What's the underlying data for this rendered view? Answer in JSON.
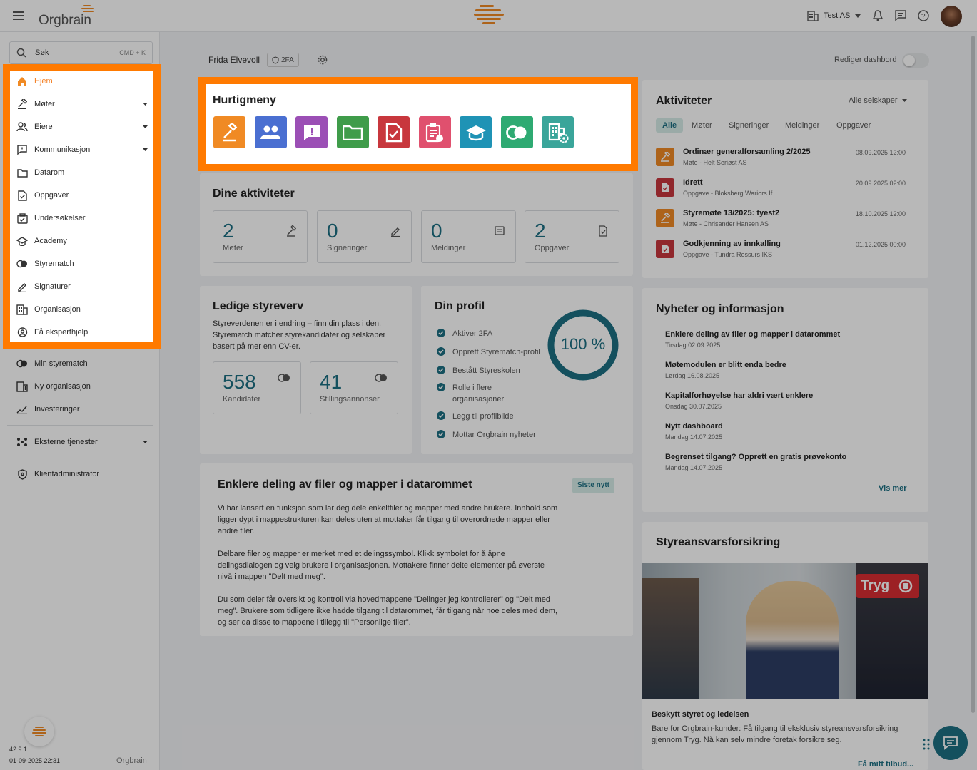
{
  "app": {
    "logo_text": "Orgbrain",
    "company_selector": "Test AS",
    "version": "42.9.1",
    "build_date": "01-09-2025 22:31",
    "footer_logo": "Orgbrain"
  },
  "search": {
    "label": "Søk",
    "shortcut": "CMD + K"
  },
  "sidebar": {
    "primary": [
      {
        "label": "Hjem",
        "icon": "home-icon",
        "active": true
      },
      {
        "label": "Møter",
        "icon": "gavel-icon",
        "chevron": true
      },
      {
        "label": "Eiere",
        "icon": "owners-icon",
        "chevron": true
      },
      {
        "label": "Kommunikasjon",
        "icon": "message-icon",
        "chevron": true
      },
      {
        "label": "Datarom",
        "icon": "folder-icon"
      },
      {
        "label": "Oppgaver",
        "icon": "task-icon"
      },
      {
        "label": "Undersøkelser",
        "icon": "survey-icon"
      },
      {
        "label": "Academy",
        "icon": "academy-icon"
      },
      {
        "label": "Styrematch",
        "icon": "styrematch-icon"
      },
      {
        "label": "Signaturer",
        "icon": "signature-icon"
      },
      {
        "label": "Organisasjon",
        "icon": "organization-icon"
      },
      {
        "label": "Få eksperthjelp",
        "icon": "expert-icon"
      }
    ],
    "secondary": [
      {
        "label": "Min styrematch"
      },
      {
        "label": "Ny organisasjon"
      },
      {
        "label": "Investeringer"
      }
    ],
    "external": "Eksterne tjenester",
    "admin": "Klientadministrator"
  },
  "header": {
    "user_name": "Frida Elvevoll",
    "twofa_badge": "2FA",
    "edit_dashboard": "Rediger dashbord"
  },
  "quickmenu": {
    "title": "Hurtigmeny",
    "items": [
      {
        "icon": "gavel-icon",
        "color": "#f08a24"
      },
      {
        "icon": "people-icon",
        "color": "#4a6fd1"
      },
      {
        "icon": "feedback-icon",
        "color": "#9b4fb5"
      },
      {
        "icon": "folder-icon",
        "color": "#3f9c4a"
      },
      {
        "icon": "task-icon",
        "color": "#c8373d"
      },
      {
        "icon": "clipboard-icon",
        "color": "#e0506e"
      },
      {
        "icon": "academy-icon",
        "color": "#1f93b5"
      },
      {
        "icon": "styrematch-icon",
        "color": "#2eaa72"
      },
      {
        "icon": "org-settings-icon",
        "color": "#3aa59a"
      }
    ]
  },
  "dine_aktiviteter": {
    "title": "Dine aktiviteter",
    "stats": [
      {
        "value": "2",
        "label": "Møter"
      },
      {
        "value": "0",
        "label": "Signeringer"
      },
      {
        "value": "0",
        "label": "Meldinger"
      },
      {
        "value": "2",
        "label": "Oppgaver"
      }
    ]
  },
  "ledige": {
    "title": "Ledige styreverv",
    "text": "Styreverdenen er i endring – finn din plass i den. Styrematch matcher styrekandidater og selskaper basert på mer enn CV-er.",
    "stats": [
      {
        "value": "558",
        "label": "Kandidater"
      },
      {
        "value": "41",
        "label": "Stillingsannonser"
      }
    ]
  },
  "profil": {
    "title": "Din profil",
    "progress": "100 %",
    "progress_value": 100,
    "items": [
      "Aktiver 2FA",
      "Opprett Styrematch-profil",
      "Bestått Styreskolen",
      "Rolle i flere organisasjoner",
      "Legg til profilbilde",
      "Mottar Orgbrain nyheter"
    ]
  },
  "article": {
    "title": "Enklere deling av filer og mapper i datarommet",
    "badge": "Siste nytt",
    "paragraphs": [
      "Vi har lansert en funksjon som lar deg dele enkeltfiler og mapper med andre brukere. Innhold som ligger dypt i mappestrukturen kan deles uten at mottaker får tilgang til overordnede mapper eller andre filer.",
      "Delbare filer og mapper er merket med et delingssymbol. Klikk symbolet for å åpne delingsdialogen og velg brukere i organisasjonen. Mottakere finner delte elementer på øverste nivå i mappen \"Delt med meg\".",
      "Du som deler får oversikt og kontroll via hovedmappene \"Delinger jeg kontrollerer\" og \"Delt med meg\". Brukere som tidligere ikke hadde tilgang til datarommet, får tilgang når noe deles med dem, og ser da disse to mappene i tillegg til \"Personlige filer\"."
    ]
  },
  "aktiviteter": {
    "title": "Aktiviteter",
    "filter": "Alle selskaper",
    "tabs": [
      "Alle",
      "Møter",
      "Signeringer",
      "Meldinger",
      "Oppgaver"
    ],
    "rows": [
      {
        "title": "Ordinær generalforsamling 2/2025",
        "sub": "Møte - Helt Seriøst AS",
        "date": "08.09.2025 12:00",
        "type": "meeting"
      },
      {
        "title": "Idrett",
        "sub": "Oppgave - Bloksberg Wariors If",
        "date": "20.09.2025 02:00",
        "type": "task"
      },
      {
        "title": "Styremøte 13/2025: tyest2",
        "sub": "Møte - Chrisander Hansen AS",
        "date": "18.10.2025 12:00",
        "type": "meeting"
      },
      {
        "title": "Godkjenning av innkalling",
        "sub": "Oppgave - Tundra Ressurs IKS",
        "date": "01.12.2025 00:00",
        "type": "task"
      }
    ]
  },
  "nyheter": {
    "title": "Nyheter og informasjon",
    "items": [
      {
        "title": "Enklere deling av filer og mapper i datarommet",
        "date": "Tirsdag 02.09.2025"
      },
      {
        "title": "Møtemodulen er blitt enda bedre",
        "date": "Lørdag 16.08.2025"
      },
      {
        "title": "Kapitalforhøyelse har aldri vært enklere",
        "date": "Onsdag 30.07.2025"
      },
      {
        "title": "Nytt dashboard",
        "date": "Mandag 14.07.2025"
      },
      {
        "title": "Begrenset tilgang? Opprett en gratis prøvekonto",
        "date": "Mandag 14.07.2025"
      }
    ],
    "more": "Vis mer"
  },
  "forsikring": {
    "title": "Styreansvarsforsikring",
    "brand": "Tryg",
    "subtitle": "Beskytt styret og ledelsen",
    "text": "Bare for Orgbrain-kunder: Få tilgang til eksklusiv styreansvarsforsikring gjennom Tryg. Nå kan selv mindre foretak forsikre seg.",
    "cta": "Få mitt tilbud..."
  },
  "colors": {
    "accent": "#f47d20",
    "teal": "#1d6f83",
    "highlight": "#ff7a00"
  }
}
